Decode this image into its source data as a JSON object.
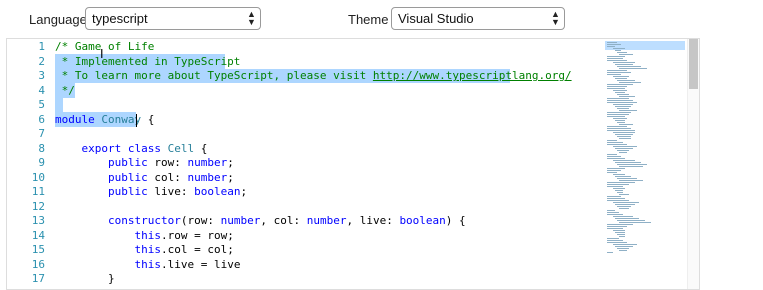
{
  "toolbar": {
    "language_label": "Language",
    "language_value": "typescript",
    "theme_label": "Theme",
    "theme_value": "Visual Studio"
  },
  "editor": {
    "line_numbers": [
      "1",
      "2",
      "3",
      "4",
      "5",
      "6",
      "7",
      "8",
      "9",
      "10",
      "11",
      "12",
      "13",
      "14",
      "15",
      "16",
      "17"
    ],
    "lines": [
      {
        "tokens": [
          {
            "t": "/* Game of Life",
            "c": "cmt"
          }
        ]
      },
      {
        "tokens": [
          {
            "t": " * Implemented in TypeScript",
            "c": "cmt"
          }
        ]
      },
      {
        "tokens": [
          {
            "t": " * To learn more about TypeScript, please visit ",
            "c": "cmt"
          },
          {
            "t": "http://www.typescriptlang.org/",
            "c": "link"
          }
        ]
      },
      {
        "tokens": [
          {
            "t": " */",
            "c": "cmt"
          }
        ]
      },
      {
        "tokens": []
      },
      {
        "tokens": [
          {
            "t": "module",
            "c": "kw"
          },
          {
            "t": " "
          },
          {
            "t": "Conway",
            "c": "ty"
          },
          {
            "t": " {"
          }
        ]
      },
      {
        "tokens": []
      },
      {
        "tokens": [
          {
            "t": "    "
          },
          {
            "t": "export",
            "c": "kw"
          },
          {
            "t": " "
          },
          {
            "t": "class",
            "c": "kw"
          },
          {
            "t": " "
          },
          {
            "t": "Cell",
            "c": "ty"
          },
          {
            "t": " {"
          }
        ]
      },
      {
        "tokens": [
          {
            "t": "        "
          },
          {
            "t": "public",
            "c": "kw"
          },
          {
            "t": " row: "
          },
          {
            "t": "number",
            "c": "kw"
          },
          {
            "t": ";"
          }
        ]
      },
      {
        "tokens": [
          {
            "t": "        "
          },
          {
            "t": "public",
            "c": "kw"
          },
          {
            "t": " col: "
          },
          {
            "t": "number",
            "c": "kw"
          },
          {
            "t": ";"
          }
        ]
      },
      {
        "tokens": [
          {
            "t": "        "
          },
          {
            "t": "public",
            "c": "kw"
          },
          {
            "t": " live: "
          },
          {
            "t": "boolean",
            "c": "kw"
          },
          {
            "t": ";"
          }
        ]
      },
      {
        "tokens": []
      },
      {
        "tokens": [
          {
            "t": "        "
          },
          {
            "t": "constructor",
            "c": "kw"
          },
          {
            "t": "(row: "
          },
          {
            "t": "number",
            "c": "kw"
          },
          {
            "t": ", col: "
          },
          {
            "t": "number",
            "c": "kw"
          },
          {
            "t": ", live: "
          },
          {
            "t": "boolean",
            "c": "kw"
          },
          {
            "t": ") {"
          }
        ]
      },
      {
        "tokens": [
          {
            "t": "            "
          },
          {
            "t": "this",
            "c": "kw"
          },
          {
            "t": ".row = row;"
          }
        ]
      },
      {
        "tokens": [
          {
            "t": "            "
          },
          {
            "t": "this",
            "c": "kw"
          },
          {
            "t": ".col = col;"
          }
        ]
      },
      {
        "tokens": [
          {
            "t": "            "
          },
          {
            "t": "this",
            "c": "kw"
          },
          {
            "t": ".live = live"
          }
        ]
      },
      {
        "tokens": [
          {
            "t": "        }"
          }
        ]
      }
    ]
  },
  "colors": {
    "selection": "#add6ff",
    "line_number": "#2b91af",
    "comment": "#008000",
    "keyword": "#0000ff",
    "type": "#267f99"
  },
  "icons": {
    "select_chevron": "chevron-updown-icon",
    "text_cursor": "ibeam-cursor-icon"
  }
}
